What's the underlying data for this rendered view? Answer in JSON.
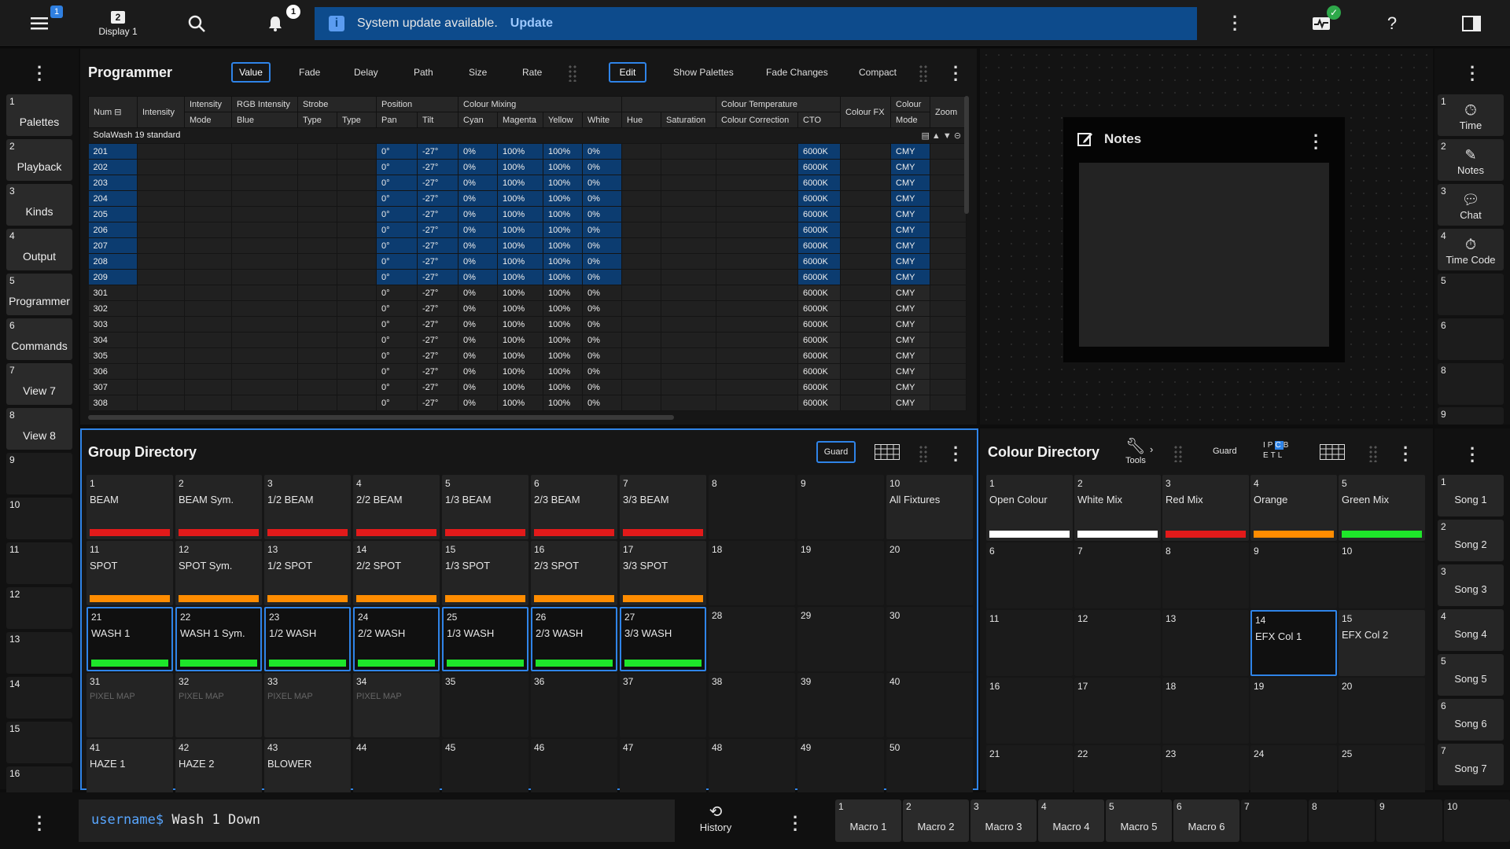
{
  "topbar": {
    "menu_badge": "1",
    "display_num": "2",
    "display_label": "Display 1",
    "bell_badge": "1",
    "banner_text": "System update available.",
    "banner_action": "Update"
  },
  "left_sidebar": [
    {
      "num": "1",
      "label": "Palettes"
    },
    {
      "num": "2",
      "label": "Playback"
    },
    {
      "num": "3",
      "label": "Kinds"
    },
    {
      "num": "4",
      "label": "Output"
    },
    {
      "num": "5",
      "label": "Programmer"
    },
    {
      "num": "6",
      "label": "Commands"
    },
    {
      "num": "7",
      "label": "View 7"
    },
    {
      "num": "8",
      "label": "View 8"
    },
    {
      "num": "9",
      "label": ""
    },
    {
      "num": "10",
      "label": ""
    },
    {
      "num": "11",
      "label": ""
    },
    {
      "num": "12",
      "label": ""
    },
    {
      "num": "13",
      "label": ""
    },
    {
      "num": "14",
      "label": ""
    },
    {
      "num": "15",
      "label": ""
    },
    {
      "num": "16",
      "label": ""
    }
  ],
  "right_sidebar": [
    {
      "num": "1",
      "label": "Time",
      "icon": "clock-icon"
    },
    {
      "num": "2",
      "label": "Notes",
      "icon": "notes-icon"
    },
    {
      "num": "3",
      "label": "Chat",
      "icon": "chat-icon"
    },
    {
      "num": "4",
      "label": "Time Code",
      "icon": "timer-icon"
    },
    {
      "num": "5",
      "label": "",
      "icon": ""
    },
    {
      "num": "6",
      "label": "",
      "icon": ""
    },
    {
      "num": "8",
      "label": "",
      "icon": ""
    },
    {
      "num": "9",
      "label": "",
      "icon": ""
    }
  ],
  "programmer": {
    "title": "Programmer",
    "tabs": [
      "Value",
      "Fade",
      "Delay",
      "Path",
      "Size",
      "Rate"
    ],
    "actions": [
      "Edit",
      "Show Palettes",
      "Fade Changes",
      "Compact"
    ],
    "header_top": [
      "Num",
      "Intensity",
      "Intensity",
      "RGB Intensity",
      "Strobe",
      "Position",
      "Colour Mixing",
      "Colour Temperature",
      "Colour FX",
      "Colour",
      "Zoom"
    ],
    "header_bottom": [
      "Mode",
      "Blue",
      "Type",
      "Type",
      "Pan",
      "Tilt",
      "Cyan",
      "Magenta",
      "Yellow",
      "White",
      "Hue",
      "Saturation",
      "Colour Correction",
      "CTO",
      "Mode"
    ],
    "fixture_type": "SolaWash 19 standard",
    "rows": [
      {
        "num": "201",
        "pan": "0°",
        "tilt": "-27°",
        "cyan": "0%",
        "magenta": "100%",
        "yellow": "100%",
        "white": "0%",
        "cto": "6000K",
        "mode": "CMY",
        "sel": true
      },
      {
        "num": "202",
        "pan": "0°",
        "tilt": "-27°",
        "cyan": "0%",
        "magenta": "100%",
        "yellow": "100%",
        "white": "0%",
        "cto": "6000K",
        "mode": "CMY",
        "sel": true
      },
      {
        "num": "203",
        "pan": "0°",
        "tilt": "-27°",
        "cyan": "0%",
        "magenta": "100%",
        "yellow": "100%",
        "white": "0%",
        "cto": "6000K",
        "mode": "CMY",
        "sel": true
      },
      {
        "num": "204",
        "pan": "0°",
        "tilt": "-27°",
        "cyan": "0%",
        "magenta": "100%",
        "yellow": "100%",
        "white": "0%",
        "cto": "6000K",
        "mode": "CMY",
        "sel": true
      },
      {
        "num": "205",
        "pan": "0°",
        "tilt": "-27°",
        "cyan": "0%",
        "magenta": "100%",
        "yellow": "100%",
        "white": "0%",
        "cto": "6000K",
        "mode": "CMY",
        "sel": true
      },
      {
        "num": "206",
        "pan": "0°",
        "tilt": "-27°",
        "cyan": "0%",
        "magenta": "100%",
        "yellow": "100%",
        "white": "0%",
        "cto": "6000K",
        "mode": "CMY",
        "sel": true
      },
      {
        "num": "207",
        "pan": "0°",
        "tilt": "-27°",
        "cyan": "0%",
        "magenta": "100%",
        "yellow": "100%",
        "white": "0%",
        "cto": "6000K",
        "mode": "CMY",
        "sel": true
      },
      {
        "num": "208",
        "pan": "0°",
        "tilt": "-27°",
        "cyan": "0%",
        "magenta": "100%",
        "yellow": "100%",
        "white": "0%",
        "cto": "6000K",
        "mode": "CMY",
        "sel": true
      },
      {
        "num": "209",
        "pan": "0°",
        "tilt": "-27°",
        "cyan": "0%",
        "magenta": "100%",
        "yellow": "100%",
        "white": "0%",
        "cto": "6000K",
        "mode": "CMY",
        "sel": true
      },
      {
        "num": "301",
        "pan": "0°",
        "tilt": "-27°",
        "cyan": "0%",
        "magenta": "100%",
        "yellow": "100%",
        "white": "0%",
        "cto": "6000K",
        "mode": "CMY",
        "sel": false
      },
      {
        "num": "302",
        "pan": "0°",
        "tilt": "-27°",
        "cyan": "0%",
        "magenta": "100%",
        "yellow": "100%",
        "white": "0%",
        "cto": "6000K",
        "mode": "CMY",
        "sel": false
      },
      {
        "num": "303",
        "pan": "0°",
        "tilt": "-27°",
        "cyan": "0%",
        "magenta": "100%",
        "yellow": "100%",
        "white": "0%",
        "cto": "6000K",
        "mode": "CMY",
        "sel": false
      },
      {
        "num": "304",
        "pan": "0°",
        "tilt": "-27°",
        "cyan": "0%",
        "magenta": "100%",
        "yellow": "100%",
        "white": "0%",
        "cto": "6000K",
        "mode": "CMY",
        "sel": false
      },
      {
        "num": "305",
        "pan": "0°",
        "tilt": "-27°",
        "cyan": "0%",
        "magenta": "100%",
        "yellow": "100%",
        "white": "0%",
        "cto": "6000K",
        "mode": "CMY",
        "sel": false
      },
      {
        "num": "306",
        "pan": "0°",
        "tilt": "-27°",
        "cyan": "0%",
        "magenta": "100%",
        "yellow": "100%",
        "white": "0%",
        "cto": "6000K",
        "mode": "CMY",
        "sel": false
      },
      {
        "num": "307",
        "pan": "0°",
        "tilt": "-27°",
        "cyan": "0%",
        "magenta": "100%",
        "yellow": "100%",
        "white": "0%",
        "cto": "6000K",
        "mode": "CMY",
        "sel": false
      },
      {
        "num": "308",
        "pan": "0°",
        "tilt": "-27°",
        "cyan": "0%",
        "magenta": "100%",
        "yellow": "100%",
        "white": "0%",
        "cto": "6000K",
        "mode": "CMY",
        "sel": false
      }
    ]
  },
  "notes": {
    "title": "Notes"
  },
  "group_directory": {
    "title": "Group Directory",
    "guard_label": "Guard",
    "cells": [
      {
        "num": "1",
        "label": "BEAM",
        "color": "#e21a1a"
      },
      {
        "num": "2",
        "label": "BEAM Sym.",
        "color": "#e21a1a"
      },
      {
        "num": "3",
        "label": "1/2 BEAM",
        "color": "#e21a1a"
      },
      {
        "num": "4",
        "label": "2/2 BEAM",
        "color": "#e21a1a"
      },
      {
        "num": "5",
        "label": "1/3 BEAM",
        "color": "#e21a1a"
      },
      {
        "num": "6",
        "label": "2/3 BEAM",
        "color": "#e21a1a"
      },
      {
        "num": "7",
        "label": "3/3 BEAM",
        "color": "#e21a1a"
      },
      {
        "num": "8",
        "label": ""
      },
      {
        "num": "9",
        "label": ""
      },
      {
        "num": "10",
        "label": "All Fixtures",
        "filled": true
      },
      {
        "num": "11",
        "label": "SPOT",
        "color": "#ff8c00"
      },
      {
        "num": "12",
        "label": "SPOT Sym.",
        "color": "#ff8c00"
      },
      {
        "num": "13",
        "label": "1/2 SPOT",
        "color": "#ff8c00"
      },
      {
        "num": "14",
        "label": "2/2 SPOT",
        "color": "#ff8c00"
      },
      {
        "num": "15",
        "label": "1/3 SPOT",
        "color": "#ff8c00"
      },
      {
        "num": "16",
        "label": "2/3 SPOT",
        "color": "#ff8c00"
      },
      {
        "num": "17",
        "label": "3/3 SPOT",
        "color": "#ff8c00"
      },
      {
        "num": "18",
        "label": ""
      },
      {
        "num": "19",
        "label": ""
      },
      {
        "num": "20",
        "label": ""
      },
      {
        "num": "21",
        "label": "WASH 1",
        "color": "#1ee62a",
        "sel": true
      },
      {
        "num": "22",
        "label": "WASH 1 Sym.",
        "color": "#1ee62a",
        "sel": true
      },
      {
        "num": "23",
        "label": "1/2 WASH",
        "color": "#1ee62a",
        "sel": true
      },
      {
        "num": "24",
        "label": "2/2 WASH",
        "color": "#1ee62a",
        "sel": true
      },
      {
        "num": "25",
        "label": "1/3 WASH",
        "color": "#1ee62a",
        "sel": true
      },
      {
        "num": "26",
        "label": "2/3 WASH",
        "color": "#1ee62a",
        "sel": true
      },
      {
        "num": "27",
        "label": "3/3 WASH",
        "color": "#1ee62a",
        "sel": true
      },
      {
        "num": "28",
        "label": ""
      },
      {
        "num": "29",
        "label": ""
      },
      {
        "num": "30",
        "label": ""
      },
      {
        "num": "31",
        "label": "PIXEL MAP",
        "dim": true
      },
      {
        "num": "32",
        "label": "PIXEL MAP",
        "dim": true
      },
      {
        "num": "33",
        "label": "PIXEL MAP",
        "dim": true
      },
      {
        "num": "34",
        "label": "PIXEL MAP",
        "dim": true
      },
      {
        "num": "35",
        "label": ""
      },
      {
        "num": "36",
        "label": ""
      },
      {
        "num": "37",
        "label": ""
      },
      {
        "num": "38",
        "label": ""
      },
      {
        "num": "39",
        "label": ""
      },
      {
        "num": "40",
        "label": ""
      },
      {
        "num": "41",
        "label": "HAZE 1",
        "filled": true
      },
      {
        "num": "42",
        "label": "HAZE 2",
        "filled": true
      },
      {
        "num": "43",
        "label": "BLOWER",
        "filled": true
      },
      {
        "num": "44",
        "label": ""
      },
      {
        "num": "45",
        "label": ""
      },
      {
        "num": "46",
        "label": ""
      },
      {
        "num": "47",
        "label": ""
      },
      {
        "num": "48",
        "label": ""
      },
      {
        "num": "49",
        "label": ""
      },
      {
        "num": "50",
        "label": ""
      }
    ]
  },
  "colour_directory": {
    "title": "Colour Directory",
    "tools_label": "Tools",
    "guard_label": "Guard",
    "mode_letters": [
      "I",
      "P",
      "C",
      "B",
      "E",
      "T",
      "L"
    ],
    "cells": [
      {
        "num": "1",
        "label": "Open Colour",
        "color": "#ffffff"
      },
      {
        "num": "2",
        "label": "White Mix",
        "color": "#ffffff"
      },
      {
        "num": "3",
        "label": "Red Mix",
        "color": "#e21a1a"
      },
      {
        "num": "4",
        "label": "Orange",
        "color": "#ff8c00"
      },
      {
        "num": "5",
        "label": "Green Mix",
        "color": "#1ee62a"
      },
      {
        "num": "6",
        "label": ""
      },
      {
        "num": "7",
        "label": ""
      },
      {
        "num": "8",
        "label": ""
      },
      {
        "num": "9",
        "label": ""
      },
      {
        "num": "10",
        "label": ""
      },
      {
        "num": "11",
        "label": ""
      },
      {
        "num": "12",
        "label": ""
      },
      {
        "num": "13",
        "label": ""
      },
      {
        "num": "14",
        "label": "EFX Col 1",
        "sel": true
      },
      {
        "num": "15",
        "label": "EFX Col 2",
        "filled": true
      },
      {
        "num": "16",
        "label": ""
      },
      {
        "num": "17",
        "label": ""
      },
      {
        "num": "18",
        "label": ""
      },
      {
        "num": "19",
        "label": ""
      },
      {
        "num": "20",
        "label": ""
      },
      {
        "num": "21",
        "label": ""
      },
      {
        "num": "22",
        "label": ""
      },
      {
        "num": "23",
        "label": ""
      },
      {
        "num": "24",
        "label": ""
      },
      {
        "num": "25",
        "label": ""
      }
    ]
  },
  "songs": [
    {
      "num": "1",
      "label": "Song 1"
    },
    {
      "num": "2",
      "label": "Song 2"
    },
    {
      "num": "3",
      "label": "Song 3"
    },
    {
      "num": "4",
      "label": "Song 4"
    },
    {
      "num": "5",
      "label": "Song 5"
    },
    {
      "num": "6",
      "label": "Song 6"
    },
    {
      "num": "7",
      "label": "Song 7"
    }
  ],
  "command_line": {
    "prompt": "username$",
    "command": "Wash 1 Down"
  },
  "history_label": "History",
  "macros": [
    {
      "num": "1",
      "label": "Macro 1"
    },
    {
      "num": "2",
      "label": "Macro 2"
    },
    {
      "num": "3",
      "label": "Macro 3"
    },
    {
      "num": "4",
      "label": "Macro 4"
    },
    {
      "num": "5",
      "label": "Macro 5"
    },
    {
      "num": "6",
      "label": "Macro 6"
    },
    {
      "num": "7",
      "label": ""
    },
    {
      "num": "8",
      "label": ""
    },
    {
      "num": "9",
      "label": ""
    },
    {
      "num": "10",
      "label": ""
    }
  ],
  "colors": {
    "accent": "#2f84e8",
    "banner": "#0d4b8c",
    "selected_cell": "#0c3c70"
  }
}
